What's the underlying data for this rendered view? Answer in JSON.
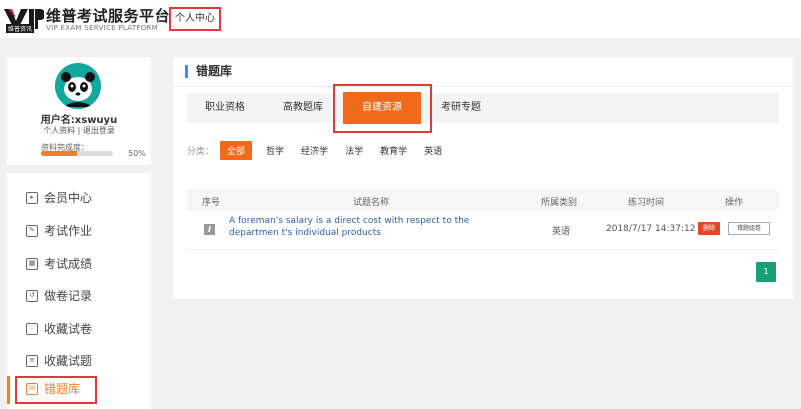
{
  "header": {
    "logo_title": "维普考试服务平台",
    "logo_sub": "VIP EXAM SERVICE PLATFORM",
    "logo_badge": "维普资讯",
    "breadcrumb_sep": "/",
    "breadcrumb": "个人中心"
  },
  "profile": {
    "username": "用户名:xswuyu",
    "link_info": "个人资料",
    "link_divider": " | ",
    "link_logout": "退出登录",
    "complete_label": "资料完成度：",
    "complete_value": 0.5,
    "complete_pct": "50%"
  },
  "sidebar": {
    "items": [
      {
        "label": "会员中心",
        "icon": "member-icon",
        "glyph": "▸"
      },
      {
        "label": "考试作业",
        "icon": "edit-icon",
        "glyph": "✎"
      },
      {
        "label": "考试成绩",
        "icon": "score-icon",
        "glyph": "▦"
      },
      {
        "label": "做卷记录",
        "icon": "history-icon",
        "glyph": "↺"
      },
      {
        "label": "收藏试卷",
        "icon": "favorite-icon",
        "glyph": "♡"
      },
      {
        "label": "收藏试题",
        "icon": "list-icon",
        "glyph": "≡"
      },
      {
        "label": "错题库",
        "icon": "wrong-book-icon",
        "glyph": "☒"
      }
    ]
  },
  "main": {
    "title": "错题库",
    "tabs": [
      {
        "label": "职业资格"
      },
      {
        "label": "高教题库"
      },
      {
        "label": "自建资源"
      },
      {
        "label": "考研专题"
      }
    ],
    "filter_label": "分类：",
    "filters": [
      "全部",
      "哲学",
      "经济学",
      "法学",
      "教育学",
      "英语"
    ],
    "table_headers": [
      "序号",
      "试题名称",
      "所属类别",
      "练习时间",
      "操作"
    ],
    "rows": [
      {
        "type_glyph": "I",
        "question": "A foreman's salary is a direct cost with respect to the departmen t's individual products",
        "category": "英语",
        "time": "2018/7/17 14:37:12",
        "btn_delete": "删除",
        "btn_group": "错题组卷"
      }
    ],
    "page": "1"
  },
  "colors": {
    "accent": "#f06a1a",
    "highlight_box": "#e03a3a",
    "page_button": "#17a078",
    "link": "#2a5fb0"
  }
}
